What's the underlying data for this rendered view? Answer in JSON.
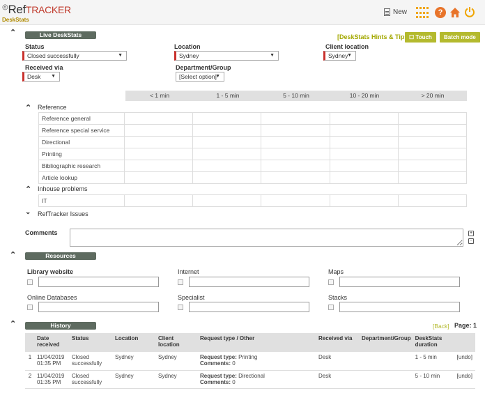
{
  "header": {
    "logo_ref": "Ref",
    "logo_tracker": "TRACKER",
    "subtitle": "DeskStats",
    "new_label": "New"
  },
  "colors": {
    "accent_olive": "#b4ba2e",
    "section_bg": "#5e6b60",
    "required_marker": "#c9302c",
    "help_orange": "#e8742a",
    "grid_orange": "#f0a500"
  },
  "live": {
    "section_title": "Live DeskStats",
    "hints_link": "[DeskStats Hints & Tips]",
    "touch_label": "Touch",
    "batch_label": "Batch mode",
    "status_label": "Status",
    "status_value": "Closed successfully",
    "location_label": "Location",
    "location_value": "Sydney",
    "client_location_label": "Client location",
    "client_location_value": "Sydney",
    "received_via_label": "Received via",
    "received_via_value": "Desk",
    "department_label": "Department/Group",
    "department_value": "[Select option]"
  },
  "durations": [
    "< 1 min",
    "1 - 5 min",
    "5 - 10 min",
    "10 - 20 min",
    "> 20 min"
  ],
  "groups": {
    "reference": {
      "title": "Reference",
      "rows": [
        "Reference general",
        "Reference special service",
        "Directional",
        "Printing",
        "Bibliographic research",
        "Article lookup"
      ]
    },
    "inhouse": {
      "title": "Inhouse problems",
      "rows": [
        "IT"
      ]
    },
    "reftracker": {
      "title": "RefTracker Issues"
    }
  },
  "comments_label": "Comments",
  "resources": {
    "section_title": "Resources",
    "library_website": "Library website",
    "internet": "Internet",
    "maps": "Maps",
    "online_databases": "Online Databases",
    "specialist": "Specialist",
    "stacks": "Stacks"
  },
  "history": {
    "section_title": "History",
    "back_link": "[Back]",
    "page_label": "Page: 1",
    "columns": [
      "",
      "Date received",
      "Status",
      "Location",
      "Client location",
      "Request type / Other",
      "Received via",
      "Department/Group",
      "DeskStats duration",
      ""
    ],
    "rows": [
      {
        "num": "1",
        "date": "11/04/2019 01:35 PM",
        "status": "Closed successfully",
        "location": "Sydney",
        "client_location": "Sydney",
        "request_type_label": "Request type:",
        "request_type": "Printing",
        "comments_label": "Comments:",
        "comments": "0",
        "received_via": "Desk",
        "department": "",
        "duration": "1 - 5 min",
        "undo": "[undo]"
      },
      {
        "num": "2",
        "date": "11/04/2019 01:35 PM",
        "status": "Closed successfully",
        "location": "Sydney",
        "client_location": "Sydney",
        "request_type_label": "Request type:",
        "request_type": "Directional",
        "comments_label": "Comments:",
        "comments": "0",
        "received_via": "Desk",
        "department": "",
        "duration": "5 - 10 min",
        "undo": "[undo]"
      }
    ]
  }
}
